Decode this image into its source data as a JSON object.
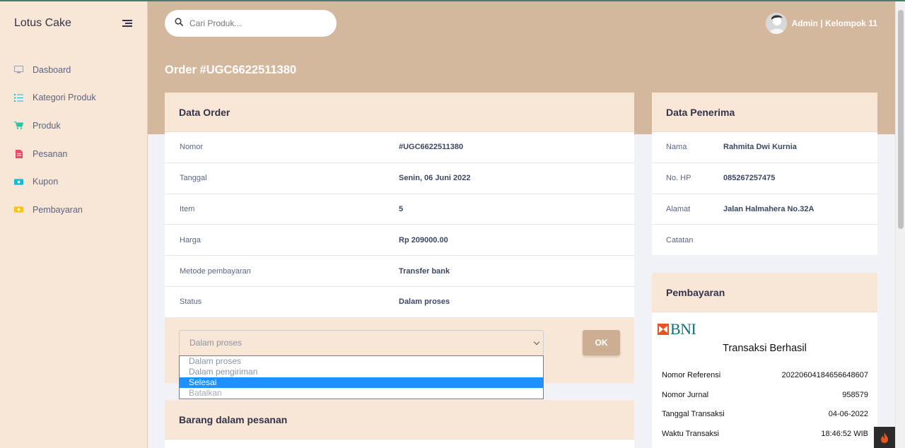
{
  "sidebar": {
    "brand": "Lotus Cake",
    "items": [
      {
        "label": "Dasboard",
        "icon": "monitor-icon",
        "color": "#9aa0b4"
      },
      {
        "label": "Kategori Produk",
        "icon": "list-icon",
        "color": "#17b8d6"
      },
      {
        "label": "Produk",
        "icon": "cart-icon",
        "color": "#21c7a8"
      },
      {
        "label": "Pesanan",
        "icon": "document-icon",
        "color": "#f04a6a"
      },
      {
        "label": "Kupon",
        "icon": "money-icon",
        "color": "#17b8d6"
      },
      {
        "label": "Pembayaran",
        "icon": "money-icon",
        "color": "#f7c318"
      }
    ]
  },
  "header": {
    "search_placeholder": "Cari Produk...",
    "user_name": "Admin | Kelompok 11"
  },
  "page": {
    "title": "Order #UGC6622511380"
  },
  "order": {
    "title": "Data Order",
    "rows": [
      {
        "key": "Nomor",
        "value": "#UGC6622511380"
      },
      {
        "key": "Tanggal",
        "value": "Senin, 06 Juni 2022"
      },
      {
        "key": "Item",
        "value": "5"
      },
      {
        "key": "Harga",
        "value": "Rp 209000.00"
      },
      {
        "key": "Metode pembayaran",
        "value": "Transfer bank"
      },
      {
        "key": "Status",
        "value": "Dalam proses"
      }
    ],
    "status_select": {
      "value": "Dalam proses",
      "options": [
        "Dalam proses",
        "Dalam pengiriman",
        "Selesai",
        "Batalkan"
      ],
      "highlighted": "Selesai"
    },
    "ok_label": "OK"
  },
  "items_section": {
    "title": "Barang dalam pesanan"
  },
  "recipient": {
    "title": "Data Penerima",
    "rows": [
      {
        "key": "Nama",
        "value": "Rahmita Dwi Kurnia"
      },
      {
        "key": "No. HP",
        "value": "085267257475"
      },
      {
        "key": "Alamat",
        "value": "Jalan Halmahera No.32A"
      },
      {
        "key": "Catatan",
        "value": ""
      }
    ]
  },
  "payment": {
    "title": "Pembayaran",
    "bank_logo_text": "BNI",
    "status_title": "Transaksi Berhasil",
    "details": [
      {
        "key": "Nomor Referensi",
        "value": "20220604184656648607"
      },
      {
        "key": "Nomor Jurnal",
        "value": "958579"
      },
      {
        "key": "Tanggal Transaksi",
        "value": "04-06-2022"
      },
      {
        "key": "Waktu Transaksi",
        "value": "18:46:52 WIB"
      }
    ]
  },
  "colors": {
    "band": "#d4b89e",
    "sidebar": "#f8e6d6",
    "accent_button": "#ccaf93",
    "bni": "#0f6e7a",
    "bni_mark": "#e8541e"
  }
}
